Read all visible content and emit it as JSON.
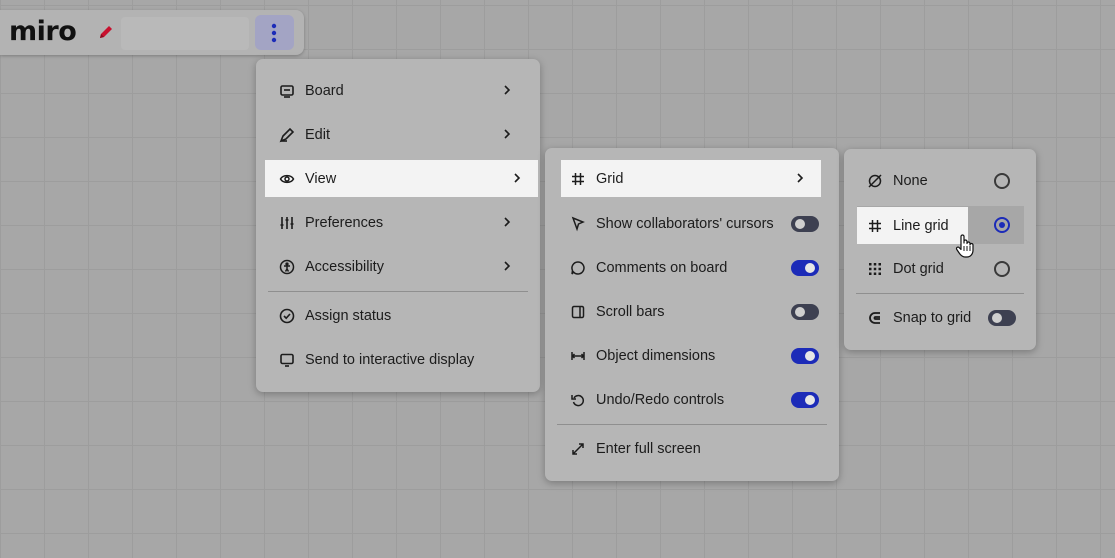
{
  "app": {
    "logo": "miro"
  },
  "main_menu": {
    "items": [
      {
        "label": "Board",
        "icon": "board-icon",
        "submenu": true
      },
      {
        "label": "Edit",
        "icon": "edit-pen-icon",
        "submenu": true
      },
      {
        "label": "View",
        "icon": "eye-icon",
        "submenu": true,
        "active": true
      },
      {
        "label": "Preferences",
        "icon": "sliders-icon",
        "submenu": true
      },
      {
        "label": "Accessibility",
        "icon": "accessibility-icon",
        "submenu": true
      },
      {
        "label": "Assign status",
        "icon": "check-circle-icon",
        "submenu": false
      },
      {
        "label": "Send to interactive display",
        "icon": "display-icon",
        "submenu": false
      }
    ]
  },
  "view_menu": {
    "items": [
      {
        "label": "Grid",
        "icon": "grid-icon",
        "submenu": true,
        "active": true
      },
      {
        "label": "Show collaborators' cursors",
        "icon": "cursor-icon",
        "toggle": false
      },
      {
        "label": "Comments on board",
        "icon": "comment-icon",
        "toggle": true
      },
      {
        "label": "Scroll bars",
        "icon": "scrollbar-icon",
        "toggle": false
      },
      {
        "label": "Object dimensions",
        "icon": "dimensions-icon",
        "toggle": true
      },
      {
        "label": "Undo/Redo controls",
        "icon": "undo-icon",
        "toggle": true
      },
      {
        "label": "Enter full screen",
        "icon": "fullscreen-icon"
      }
    ]
  },
  "grid_menu": {
    "items": [
      {
        "label": "None",
        "icon": "no-grid-icon",
        "selected": false
      },
      {
        "label": "Line grid",
        "icon": "line-grid-icon",
        "selected": true
      },
      {
        "label": "Dot grid",
        "icon": "dot-grid-icon",
        "selected": false
      },
      {
        "label": "Snap to grid",
        "icon": "magnet-icon",
        "toggle": false
      }
    ]
  },
  "colors": {
    "accent": "#1c2bb8",
    "toggle_off": "#3d4051",
    "logo_pencil": "#c8102e",
    "highlight": "#f3f3f3"
  }
}
